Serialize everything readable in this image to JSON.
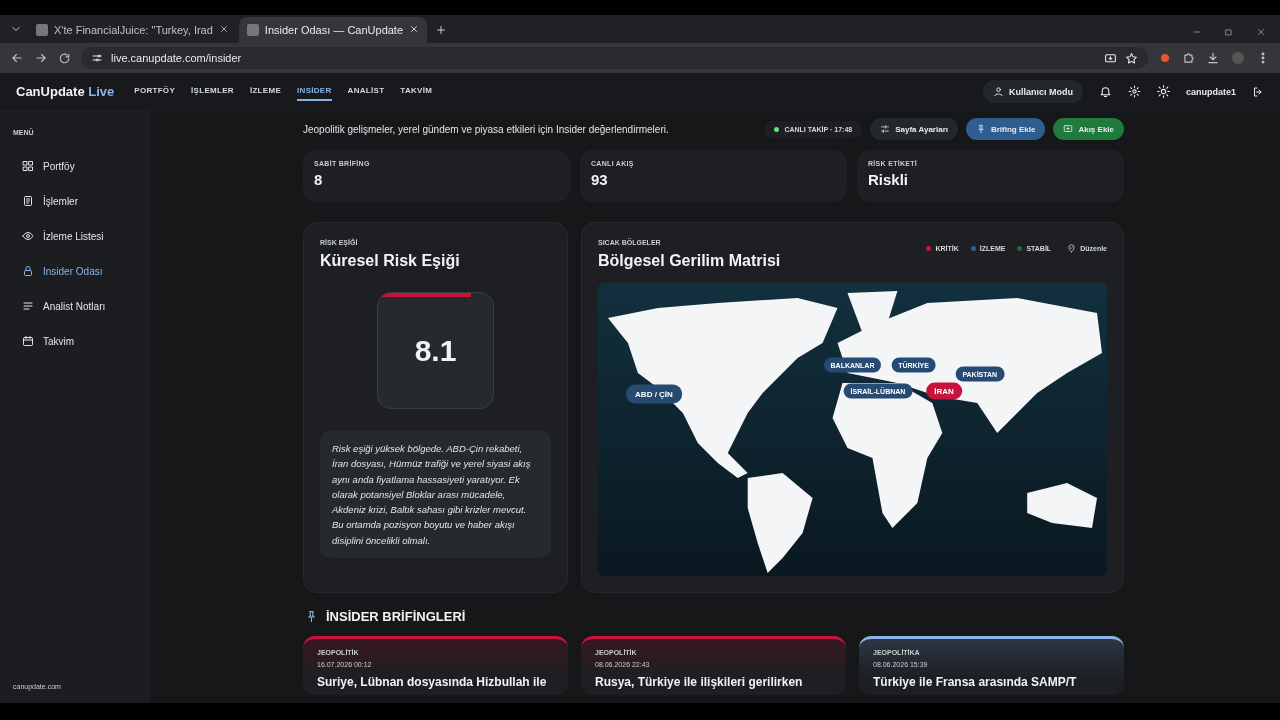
{
  "browser": {
    "tabs": [
      {
        "title": "X'te FinancialJuice: \"Turkey, Irad",
        "selected": false
      },
      {
        "title": "Insider Odası — CanUpdate",
        "selected": true
      }
    ],
    "url": "live.canupdate.com/insider"
  },
  "header": {
    "brand": "CanUpdate",
    "brand_accent": "Live",
    "nav": [
      {
        "label": "PORTFÖY",
        "selected": false
      },
      {
        "label": "İŞLEMLER",
        "selected": false
      },
      {
        "label": "İZLEME",
        "selected": false
      },
      {
        "label": "INSİDER",
        "selected": true
      },
      {
        "label": "ANALİST",
        "selected": false
      },
      {
        "label": "TAKVİM",
        "selected": false
      }
    ],
    "mode_button": "Kullanıcı Modu",
    "user": "canupdate1"
  },
  "sidebar": {
    "title": "MENÜ",
    "items": [
      {
        "label": "Portföy",
        "selected": false
      },
      {
        "label": "İşlemler",
        "selected": false
      },
      {
        "label": "İzleme Listesi",
        "selected": false
      },
      {
        "label": "Insider Odası",
        "selected": true
      },
      {
        "label": "Analist Notları",
        "selected": false
      },
      {
        "label": "Takvim",
        "selected": false
      }
    ],
    "footer": "canupdate.com"
  },
  "page": {
    "subtitle": "Jeopolitik gelişmeler, yerel gündem ve piyasa etkileri için Insider değerlendirmeleri.",
    "live": {
      "label": "CANLI TAKİP · 17:48",
      "on": true
    },
    "buttons": [
      {
        "label": "Sayfa Ayarları",
        "kind": "plain"
      },
      {
        "label": "Brifing Ekle",
        "kind": "blue"
      },
      {
        "label": "Akış Ekle",
        "kind": "green"
      }
    ]
  },
  "stats": [
    {
      "label": "SABİT BRİFİNG",
      "value": "8"
    },
    {
      "label": "CANLI AKIŞ",
      "value": "93"
    },
    {
      "label": "RİSK ETİKETİ",
      "value": "Riskli"
    }
  ],
  "risk": {
    "eyebrow": "RİSK EŞİĞİ",
    "title": "Küresel Risk Eşiği",
    "score": "8.1",
    "level": 0.81,
    "note": "Risk eşiği yüksek bölgede. ABD-Çin rekabeti, İran dosyası, Hürmüz trafiği ve yerel siyasi akış aynı anda fiyatlama hassasiyeti yaratıyor. Ek olarak potansiyel Bloklar arası mücadele, Akdeniz krizi, Baltık sahası gibi krizler mevcut. Bu ortamda pozisyon boyutu ve haber akışı disiplini öncelikli olmalı."
  },
  "map": {
    "eyebrow": "SICAK BÖLGELER",
    "title": "Bölgesel Gerilim Matrisi",
    "legend": [
      {
        "label": "KRİTİK",
        "color": "#c8143c"
      },
      {
        "label": "İZLEME",
        "color": "#2f5f9a"
      },
      {
        "label": "STABİL",
        "color": "#1f6b3a"
      }
    ],
    "edit": "Düzenle",
    "hotspots": [
      {
        "label": "ABD / ÇİN",
        "kind": "watch"
      },
      {
        "label": "BALKANLAR",
        "kind": "watch"
      },
      {
        "label": "TÜRKİYE",
        "kind": "watch"
      },
      {
        "label": "İSRAİL-LÜBNAN",
        "kind": "watch"
      },
      {
        "label": "İRAN",
        "kind": "critical"
      },
      {
        "label": "PAKİSTAN",
        "kind": "watch"
      }
    ]
  },
  "briefs": {
    "title": "İNSİDER BRİFİNGLERİ",
    "items": [
      {
        "category": "JEOPOLİTİK",
        "date": "16.07.2026 00:12",
        "headline": "Suriye, Lübnan dosyasında Hizbullah ile",
        "color": "#c8143c"
      },
      {
        "category": "JEOPOLİTİK",
        "date": "08.06.2026 22:43",
        "headline": "Rusya, Türkiye ile ilişkileri gerilirken",
        "color": "#c8143c"
      },
      {
        "category": "JEOPOLİTİKA",
        "date": "08.06.2026 15:39",
        "headline": "Türkiye ile Fransa arasında SAMP/T",
        "color": "#8ab4e8"
      }
    ]
  }
}
